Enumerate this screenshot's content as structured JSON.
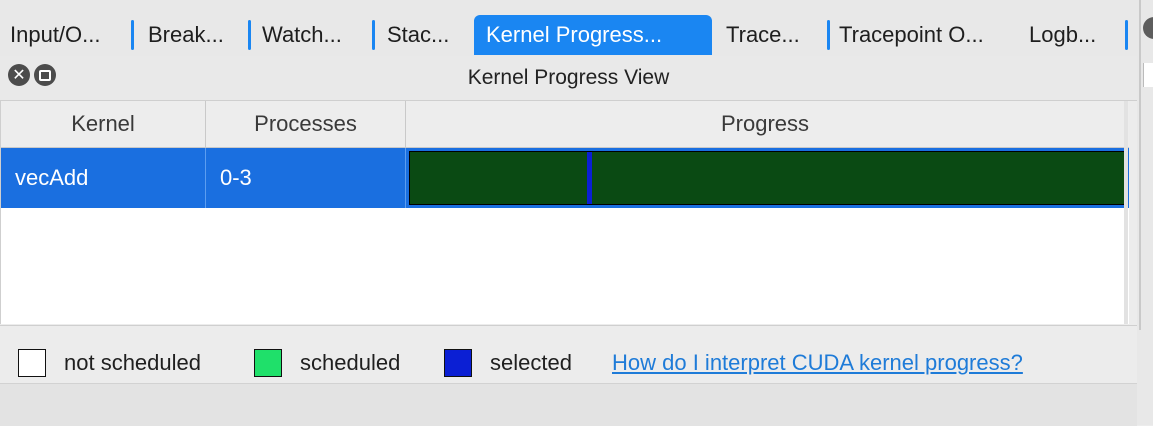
{
  "tabs": [
    {
      "label": "Input/O..."
    },
    {
      "label": "Break..."
    },
    {
      "label": "Watch..."
    },
    {
      "label": "Stac..."
    },
    {
      "label": "Kernel Progress...",
      "active": true
    },
    {
      "label": "Trace..."
    },
    {
      "label": "Tracepoint O..."
    },
    {
      "label": "Logb..."
    }
  ],
  "view": {
    "title": "Kernel Progress View",
    "close_glyph": "✕"
  },
  "table": {
    "columns": [
      "Kernel",
      "Processes",
      "Progress"
    ],
    "rows": [
      {
        "kernel": "vecAdd",
        "processes": "0-3",
        "progress_selected_marker_fraction": 0.25
      }
    ]
  },
  "legend": {
    "items": [
      {
        "label": "not scheduled",
        "color": "#ffffff"
      },
      {
        "label": "scheduled",
        "color": "#1fe06a"
      },
      {
        "label": "selected",
        "color": "#0b1fd4"
      }
    ],
    "help_link": "How do I interpret CUDA kernel progress?"
  },
  "colors": {
    "accent": "#1a86f2",
    "selected_row": "#1a6fe0",
    "progress_fill": "#0a4a13",
    "link": "#1e7bd8"
  }
}
